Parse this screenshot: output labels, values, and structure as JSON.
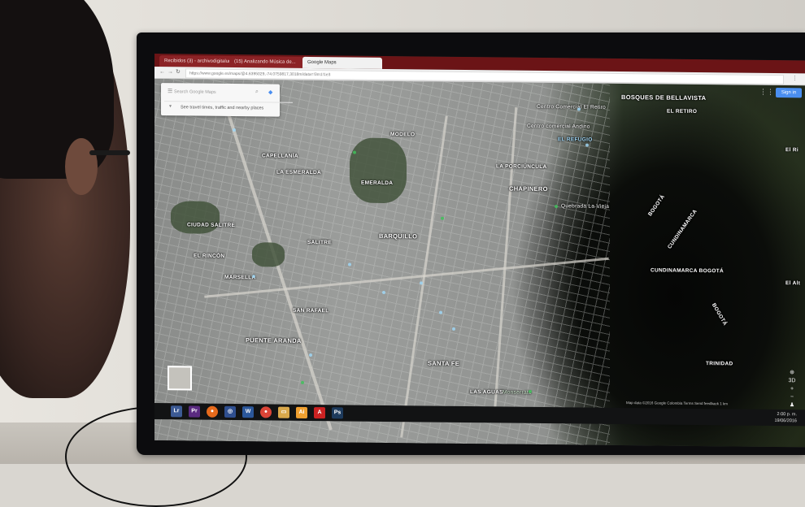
{
  "browser": {
    "tabs": [
      {
        "label": "Recibidos (3) - archivodigitalun..."
      },
      {
        "label": "(15) Analizando Música de..."
      },
      {
        "label": "Google Maps"
      }
    ],
    "url": "https://www.google.es/maps/@4.6395029,-74.0759817,3018m/data=!3m1!1e3"
  },
  "maps": {
    "search_placeholder": "Search Google Maps",
    "search_hint": "See travel times, traffic and nearby places",
    "sign_in": "Sign in",
    "labels": [
      "BOSQUES DE BELLAVISTA",
      "EL RETIRO",
      "EL REFUGIO",
      "Centro comercial Andino",
      "Centro Comercial El Retiro",
      "CHAPINERO",
      "LA PORCIÚNCULA",
      "Quebrada La Vieja",
      "BOGOTÁ",
      "CUNDINAMARCA",
      "CUNDINAMARCA BOGOTÁ",
      "BOGOTÁ",
      "TRINIDAD",
      "EL RINCÓN",
      "BARQUILLO",
      "SANTA FE",
      "EMERALDA",
      "CAPELLANÍA",
      "MODELO",
      "SALITRE",
      "LA ESMERALDA",
      "PUENTE ARANDA",
      "SAN RAFAEL",
      "CIUDAD SALITRE",
      "MARSELLA",
      "LAS AGUAS",
      "Monserrate",
      "El Ri",
      "El Alt"
    ],
    "footer": "Map data ©2016 Google   Colombia   Terms   Send feedback   1 km"
  },
  "taskbar": {
    "time": "2:00 p. m.",
    "date": "19/06/2016"
  }
}
